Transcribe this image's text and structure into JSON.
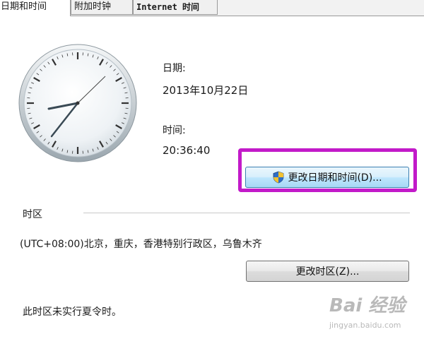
{
  "tabs": [
    {
      "label": "日期和时间",
      "active": true
    },
    {
      "label": "附加时钟",
      "active": false
    },
    {
      "label": "Internet 时间",
      "active": false
    }
  ],
  "date": {
    "label": "日期:",
    "value": "2013年10月22日"
  },
  "time": {
    "label": "时间:",
    "value": "20:36:40"
  },
  "change_datetime_button": "更改日期和时间(D)...",
  "timezone": {
    "group_label": "时区",
    "value": "(UTC+08:00)北京，重庆，香港特别行政区，乌鲁木齐",
    "change_button": "更改时区(Z)...",
    "dst_note": "此时区未实行夏令时。"
  },
  "watermark": {
    "main": "Bai 经验",
    "sub": "jingyan.baidu.com"
  },
  "colors": {
    "highlight": "#c21ac9",
    "button_focus": "#3c7fb1"
  },
  "icons": {
    "uac_shield": "shield-icon"
  }
}
